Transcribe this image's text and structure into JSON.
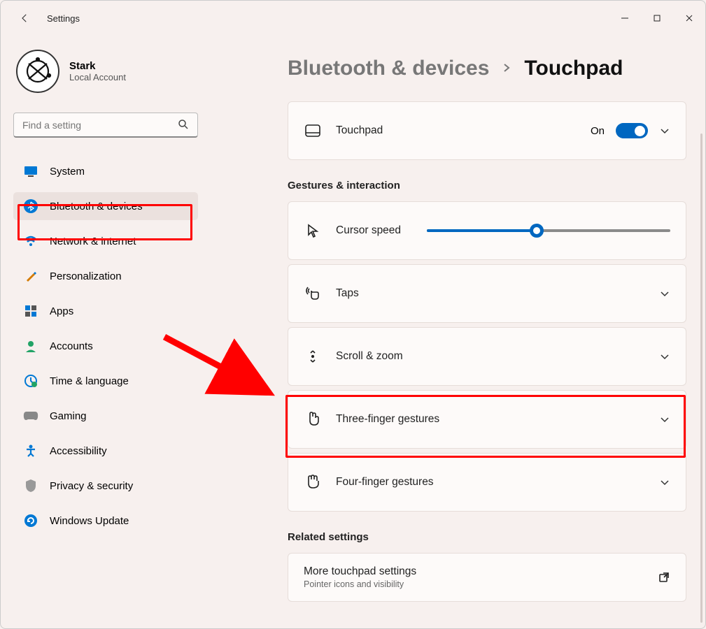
{
  "window": {
    "title": "Settings"
  },
  "profile": {
    "name": "Stark",
    "subtitle": "Local Account"
  },
  "search": {
    "placeholder": "Find a setting"
  },
  "nav": {
    "items": [
      {
        "label": "System"
      },
      {
        "label": "Bluetooth & devices"
      },
      {
        "label": "Network & internet"
      },
      {
        "label": "Personalization"
      },
      {
        "label": "Apps"
      },
      {
        "label": "Accounts"
      },
      {
        "label": "Time & language"
      },
      {
        "label": "Gaming"
      },
      {
        "label": "Accessibility"
      },
      {
        "label": "Privacy & security"
      },
      {
        "label": "Windows Update"
      }
    ]
  },
  "breadcrumb": {
    "parent": "Bluetooth & devices",
    "current": "Touchpad"
  },
  "touchpad_card": {
    "label": "Touchpad",
    "state_label": "On",
    "state": true
  },
  "sections": {
    "gestures": "Gestures & interaction",
    "related": "Related settings"
  },
  "gesture_rows": {
    "cursor_speed": {
      "label": "Cursor speed",
      "value_percent": 45
    },
    "taps": {
      "label": "Taps"
    },
    "scroll_zoom": {
      "label": "Scroll & zoom"
    },
    "three_finger": {
      "label": "Three-finger gestures"
    },
    "four_finger": {
      "label": "Four-finger gestures"
    }
  },
  "related_rows": {
    "more": {
      "label": "More touchpad settings",
      "subtitle": "Pointer icons and visibility"
    }
  },
  "colors": {
    "accent": "#0067c0",
    "highlight": "#ff0000"
  }
}
